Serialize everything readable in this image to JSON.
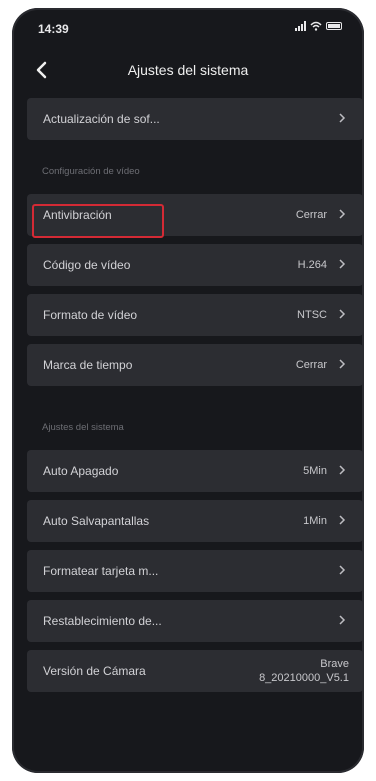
{
  "status_bar": {
    "time": "14:39"
  },
  "header": {
    "title": "Ajustes del sistema"
  },
  "top_item": {
    "label": "Actualización de sof..."
  },
  "section1": {
    "title": "Configuración de vídeo",
    "items": [
      {
        "label": "Antivibración",
        "value": "Cerrar"
      },
      {
        "label": "Código de vídeo",
        "value": "H.264"
      },
      {
        "label": "Formato de vídeo",
        "value": "NTSC"
      },
      {
        "label": "Marca de tiempo",
        "value": "Cerrar"
      }
    ]
  },
  "section2": {
    "title": "Ajustes del sistema",
    "items": [
      {
        "label": "Auto Apagado",
        "value": "5Min"
      },
      {
        "label": "Auto Salvapantallas",
        "value": "1Min"
      },
      {
        "label": "Formatear tarjeta m...",
        "value": ""
      },
      {
        "label": "Restablecimiento de...",
        "value": ""
      }
    ]
  },
  "version": {
    "label": "Versión de Cámara",
    "value_line1": "Brave",
    "value_line2": "8_20210000_V5.1"
  },
  "colors": {
    "background": "#17181c",
    "row": "#2c2d32",
    "highlight": "#d42a35"
  },
  "icons": {
    "back": "chevron-left-icon",
    "row_arrow": "chevron-right-icon"
  }
}
